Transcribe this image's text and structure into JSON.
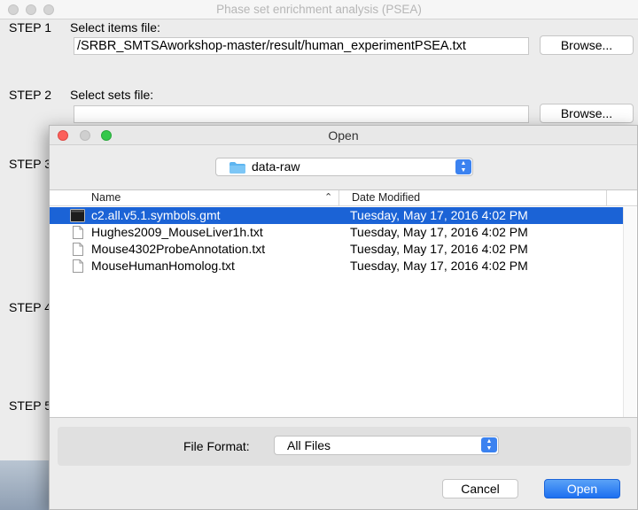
{
  "background_window": {
    "title": "Phase set enrichment analysis (PSEA)",
    "steps": [
      {
        "label": "STEP 1",
        "desc": "Select items file:",
        "value": "/SRBR_SMTSAworkshop-master/result/human_experimentPSEA.txt",
        "button": "Browse..."
      },
      {
        "label": "STEP 2",
        "desc": "Select sets file:",
        "value": "",
        "button": "Browse..."
      },
      {
        "label": "STEP 3"
      },
      {
        "label": "STEP 4"
      },
      {
        "label": "STEP 5"
      }
    ]
  },
  "dialog": {
    "title": "Open",
    "folder": "data-raw",
    "columns": {
      "name": "Name",
      "date": "Date Modified"
    },
    "files": [
      {
        "name": "c2.all.v5.1.symbols.gmt",
        "date": "Tuesday, May 17, 2016 4:02 PM",
        "selected": true,
        "icon": "terminal-file-icon"
      },
      {
        "name": "Hughes2009_MouseLiver1h.txt",
        "date": "Tuesday, May 17, 2016 4:02 PM",
        "selected": false,
        "icon": "text-file-icon"
      },
      {
        "name": "Mouse4302ProbeAnnotation.txt",
        "date": "Tuesday, May 17, 2016 4:02 PM",
        "selected": false,
        "icon": "text-file-icon"
      },
      {
        "name": "MouseHumanHomolog.txt",
        "date": "Tuesday, May 17, 2016 4:02 PM",
        "selected": false,
        "icon": "text-file-icon"
      }
    ],
    "file_format_label": "File Format:",
    "file_format_value": "All Files",
    "cancel_label": "Cancel",
    "open_label": "Open"
  },
  "colors": {
    "selection": "#1b63d6",
    "accent": "#3b82f0",
    "close": "#fc605b",
    "minimize": "#c8c8c8",
    "zoom": "#34c84a"
  }
}
